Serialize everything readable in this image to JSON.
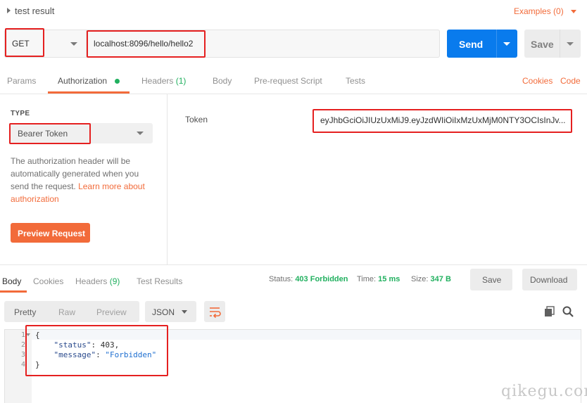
{
  "header": {
    "title": "test result",
    "examples_label": "Examples (0)"
  },
  "request": {
    "method": "GET",
    "url": "localhost:8096/hello/hello2",
    "send_label": "Send",
    "save_label": "Save"
  },
  "request_tabs": {
    "params": "Params",
    "authorization": "Authorization",
    "headers": "Headers",
    "headers_count": "(1)",
    "body": "Body",
    "pre_request": "Pre-request Script",
    "tests": "Tests",
    "cookies": "Cookies",
    "code": "Code"
  },
  "authorization": {
    "type_label": "TYPE",
    "type_value": "Bearer Token",
    "description": "The authorization header will be automatically generated when you send the request.",
    "learn_more": "Learn more about authorization",
    "preview_button": "Preview Request",
    "token_label": "Token",
    "token_value": "eyJhbGciOiJIUzUxMiJ9.eyJzdWIiOiIxMzUxMjM0NTY3OCIsInJv..."
  },
  "response_tabs": {
    "body": "Body",
    "cookies": "Cookies",
    "headers": "Headers",
    "headers_count": "(9)",
    "test_results": "Test Results"
  },
  "response_meta": {
    "status_label": "Status:",
    "status_value": "403 Forbidden",
    "time_label": "Time:",
    "time_value": "15 ms",
    "size_label": "Size:",
    "size_value": "347 B",
    "save_label": "Save",
    "download_label": "Download"
  },
  "view": {
    "pretty": "Pretty",
    "raw": "Raw",
    "preview": "Preview",
    "format": "JSON"
  },
  "code": {
    "line_numbers": [
      "1",
      "2",
      "3",
      "4"
    ],
    "open_brace": "{",
    "status_key": "\"status\"",
    "status_value": "403,",
    "message_key": "\"message\"",
    "message_value": "\"Forbidden\"",
    "close_brace": "}"
  },
  "watermark": "qikegu.com",
  "colors": {
    "accent": "#f26b3a",
    "send_blue": "#097bed",
    "status_green": "#21b05f",
    "highlight_red": "#e52020"
  }
}
